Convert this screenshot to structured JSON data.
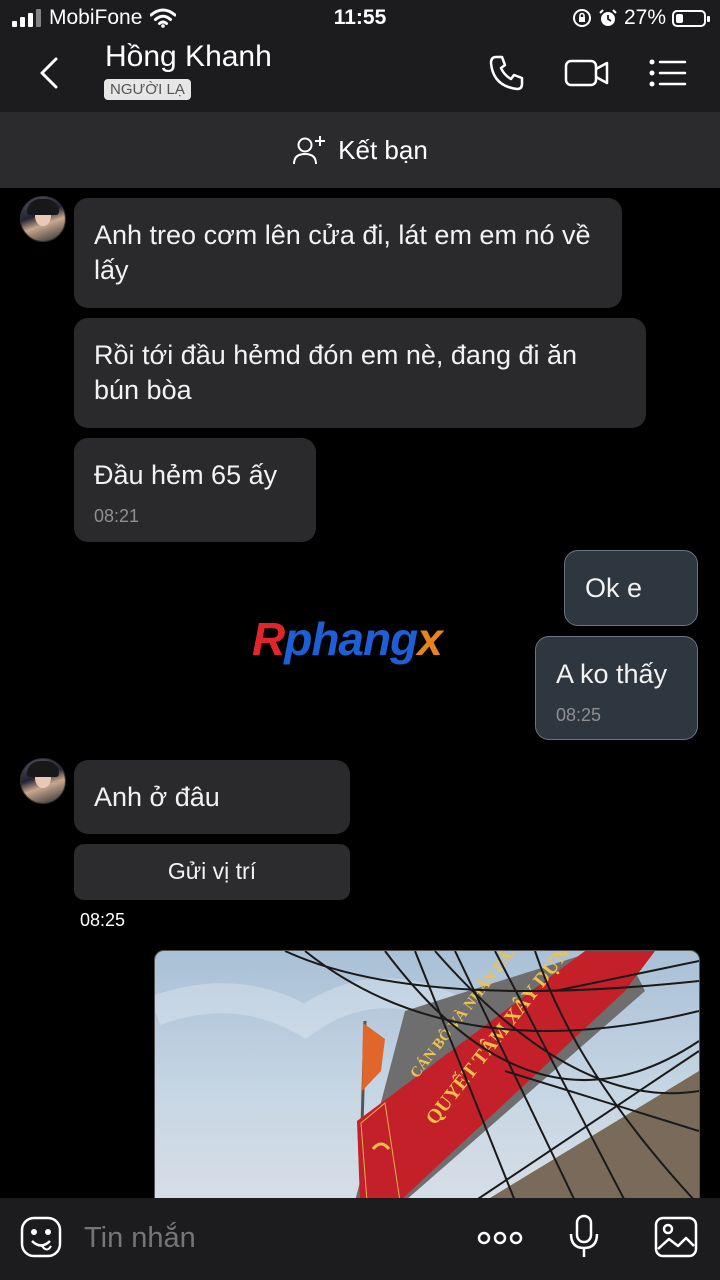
{
  "status": {
    "carrier": "MobiFone",
    "time": "11:55",
    "battery": "27%",
    "battery_level": 0.27
  },
  "header": {
    "contact_name": "Hồng Khanh",
    "badge": "NGƯỜI LẠ"
  },
  "add_friend": {
    "label": "Kết bạn"
  },
  "messages": {
    "m1": "Anh treo cơm lên cửa đi, lát em em nó về lấy",
    "m2": "Rồi tới đầu hẻmd đón em nè, đang đi ăn bún bòa",
    "m3": "Đầu hẻm 65 ấy",
    "m3_time": "08:21",
    "m4": "Ok e",
    "m5": "A ko thấy",
    "m5_time": "08:25",
    "m6": "Anh ở đâu",
    "send_location": "Gửi vị trí",
    "m6_time": "08:25"
  },
  "watermark": {
    "part1": "R",
    "part2": "phang",
    "part3": "x",
    "color1": "#e0262b",
    "color2": "#1e5fd6",
    "color3": "#e8841e"
  },
  "photo": {
    "banner_text": "QUYẾT TÂM XÂY DỰNG",
    "banner_text_top": "CÁN BỘ VÀ NHÂN DÂN"
  },
  "composer": {
    "placeholder": "Tin nhắn"
  },
  "icons": [
    "back-icon",
    "phone-icon",
    "video-call-icon",
    "menu-icon",
    "add-friend-icon",
    "emoji-icon",
    "more-icon",
    "mic-icon",
    "gallery-icon"
  ]
}
